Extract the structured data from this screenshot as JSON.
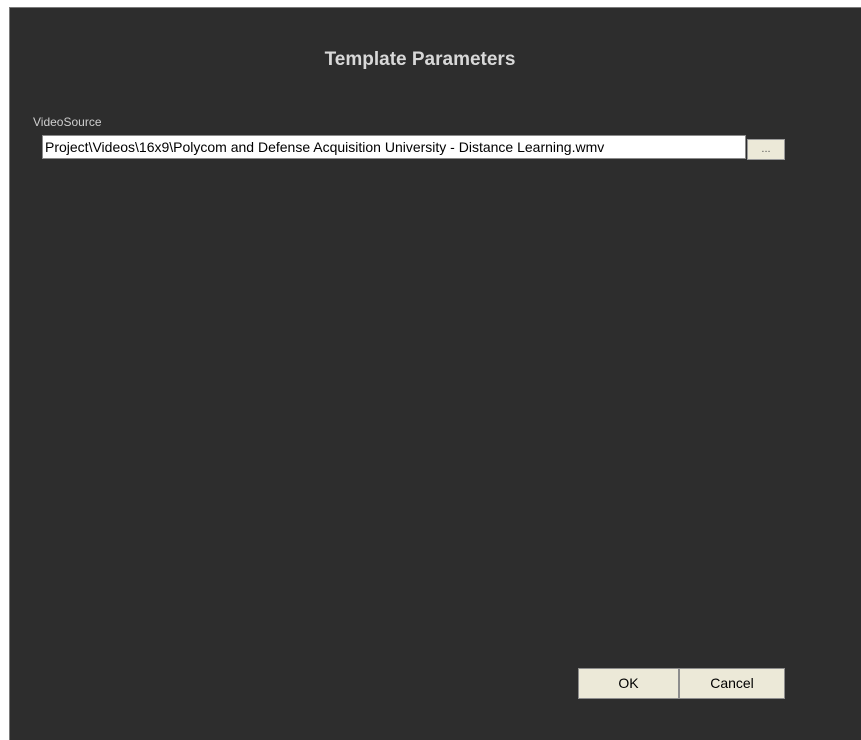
{
  "dialog": {
    "title": "Template Parameters",
    "fields": [
      {
        "label": "VideoSource",
        "value": "Project\\Videos\\16x9\\Polycom and Defense Acquisition University - Distance Learning.wmv",
        "browse_label": "..."
      }
    ],
    "buttons": {
      "ok_label": "OK",
      "cancel_label": "Cancel"
    }
  },
  "colors": {
    "dialog_background": "#2d2d2d",
    "text_light": "#d8d8d8",
    "button_face": "#ece9d8"
  }
}
